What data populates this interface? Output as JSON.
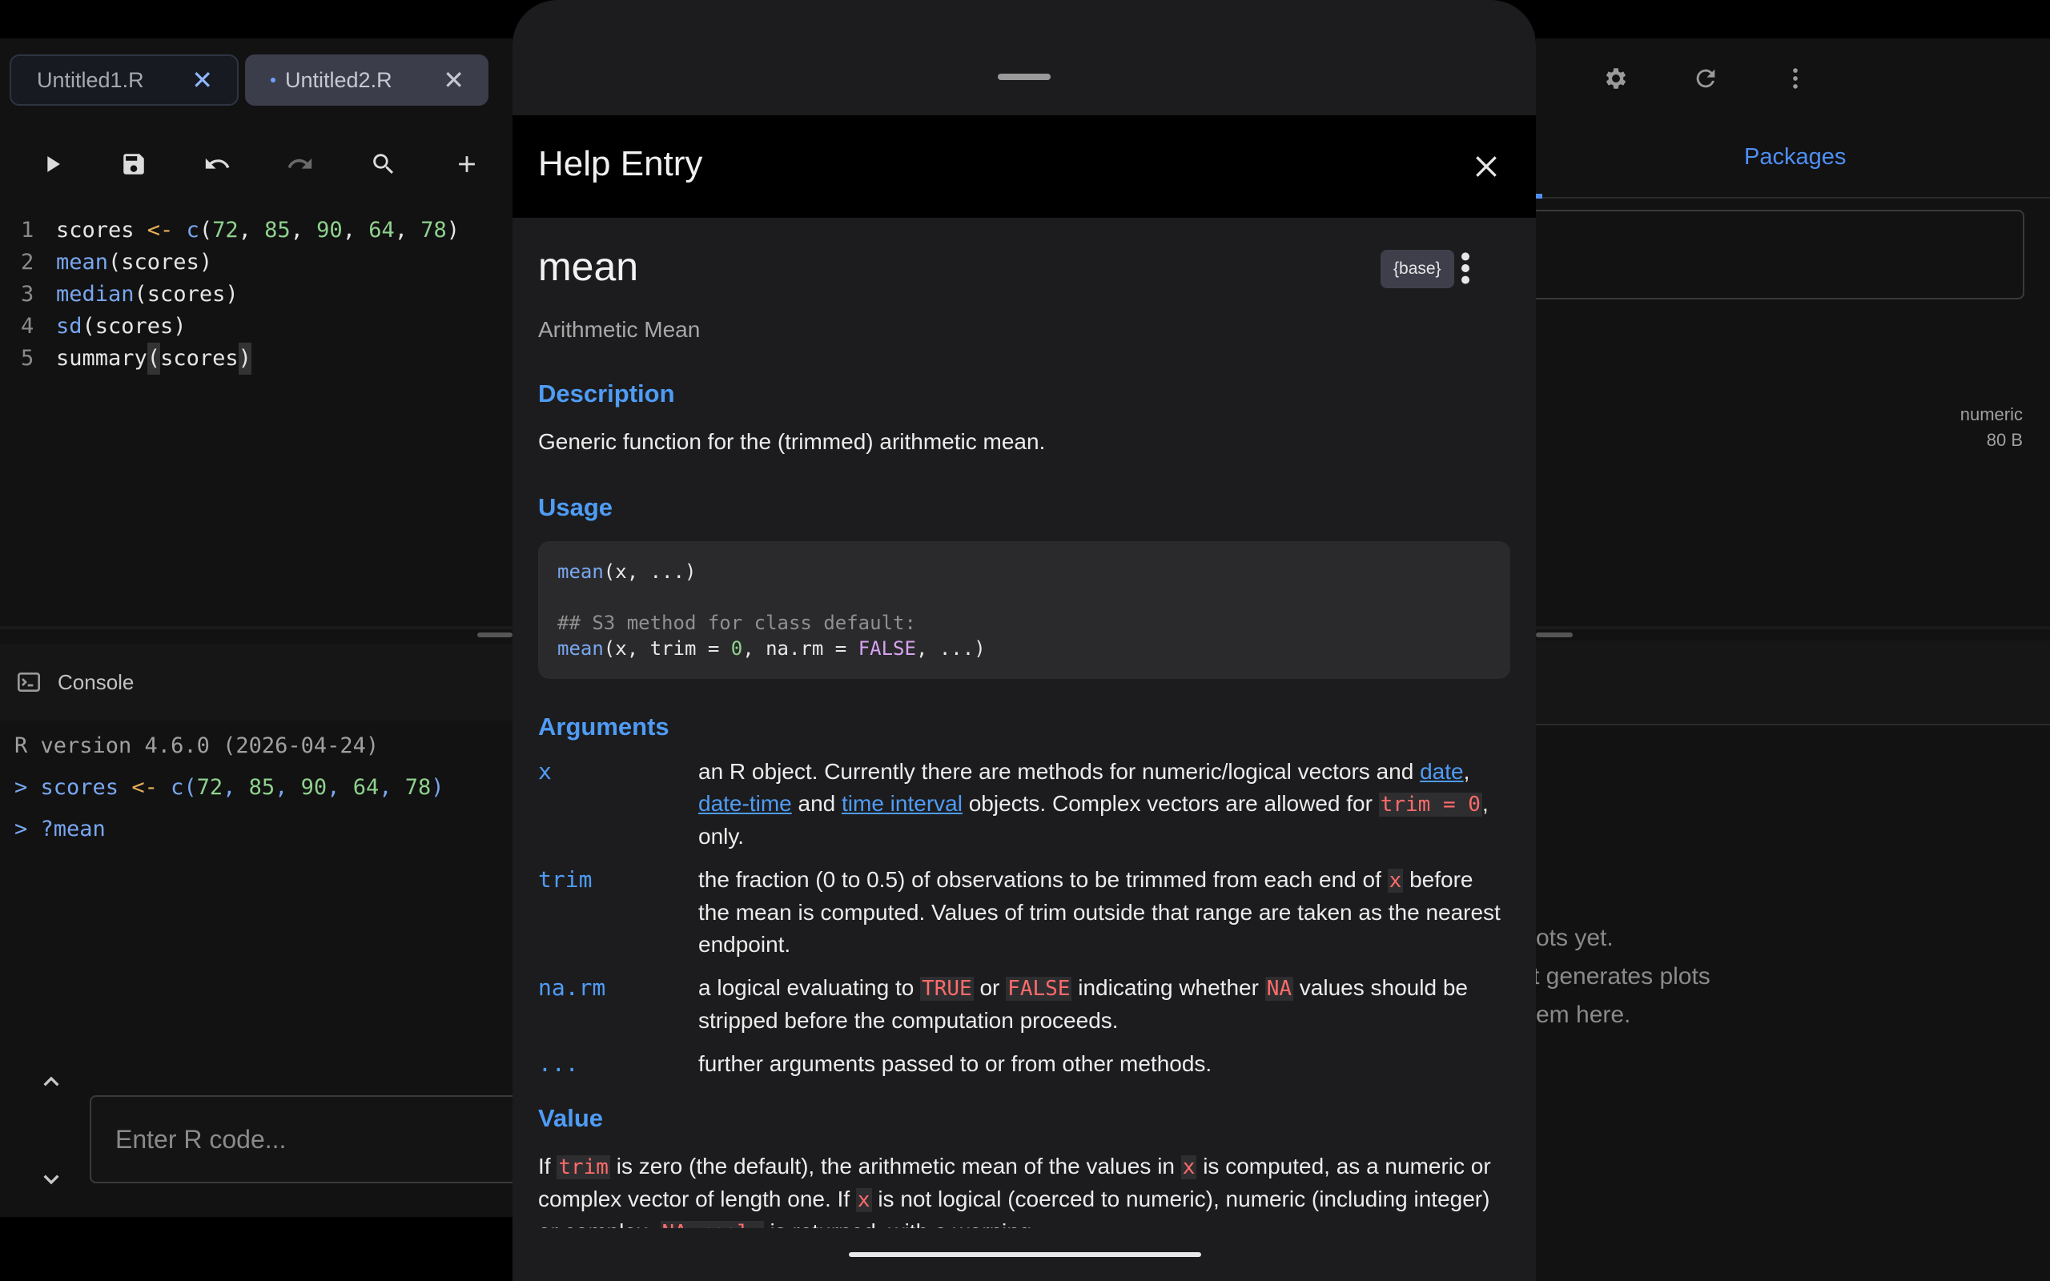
{
  "editor": {
    "tabs": [
      {
        "label": "Untitled1.R",
        "close": "✕"
      },
      {
        "label": "Untitled2.R",
        "close": "✕"
      }
    ],
    "code_lines": [
      {
        "n": "1",
        "parts": [
          [
            "scores ",
            "txt"
          ],
          [
            "<-",
            "op"
          ],
          [
            " ",
            "txt"
          ],
          [
            "c",
            "fn"
          ],
          [
            "(",
            "txt"
          ],
          [
            "72",
            "num"
          ],
          [
            ", ",
            "txt"
          ],
          [
            "85",
            "num"
          ],
          [
            ", ",
            "txt"
          ],
          [
            "90",
            "num"
          ],
          [
            ", ",
            "txt"
          ],
          [
            "64",
            "num"
          ],
          [
            ", ",
            "txt"
          ],
          [
            "78",
            "num"
          ],
          [
            ")",
            "txt"
          ]
        ]
      },
      {
        "n": "2",
        "parts": [
          [
            "mean",
            "fn"
          ],
          [
            "(scores)",
            "txt"
          ]
        ]
      },
      {
        "n": "3",
        "parts": [
          [
            "median",
            "fn"
          ],
          [
            "(scores)",
            "txt"
          ]
        ]
      },
      {
        "n": "4",
        "parts": [
          [
            "sd",
            "fn"
          ],
          [
            "(scores)",
            "txt"
          ]
        ]
      },
      {
        "n": "5",
        "parts": [
          [
            "summary",
            "txt"
          ],
          [
            "(",
            "hl"
          ],
          [
            "scores",
            "txt"
          ],
          [
            ")",
            "hl"
          ]
        ]
      }
    ]
  },
  "console": {
    "title": "Console",
    "lines": [
      {
        "prompt": "",
        "parts": [
          [
            "R version 4.6.0 (2026-04-24)",
            "dim"
          ]
        ]
      },
      {
        "prompt": "> ",
        "parts": [
          [
            "scores ",
            "fn"
          ],
          [
            "<-",
            "op"
          ],
          [
            " c(",
            "fn"
          ],
          [
            "72",
            "num"
          ],
          [
            ", ",
            "fn"
          ],
          [
            "85",
            "num"
          ],
          [
            ", ",
            "fn"
          ],
          [
            "90",
            "num"
          ],
          [
            ", ",
            "fn"
          ],
          [
            "64",
            "num"
          ],
          [
            ", ",
            "fn"
          ],
          [
            "78",
            "num"
          ],
          [
            ")",
            "fn"
          ]
        ]
      },
      {
        "prompt": "> ",
        "parts": [
          [
            "?mean",
            "fn"
          ]
        ]
      }
    ],
    "input_placeholder": "Enter R code..."
  },
  "right_pane": {
    "tab_label": "Packages",
    "env_type": "numeric",
    "env_size": "80 B",
    "empty_lines": [
      "ots yet.",
      "t generates plots",
      "em here."
    ]
  },
  "help": {
    "header_title": "Help Entry",
    "function_name": "mean",
    "package": "{base}",
    "subtitle": "Arithmetic Mean",
    "description_heading": "Description",
    "description": "Generic function for the (trimmed) arithmetic mean.",
    "usage_heading": "Usage",
    "arguments_heading": "Arguments",
    "value_heading": "Value",
    "arguments": [
      {
        "name": "x",
        "desc": [
          [
            "an R object. Currently there are methods for numeric/logical vectors and ",
            "t"
          ],
          [
            "date",
            "link"
          ],
          [
            ",\n",
            "t"
          ],
          [
            "date-time",
            "link"
          ],
          [
            " and ",
            "t"
          ],
          [
            "time interval",
            "link"
          ],
          [
            " objects. Complex vectors are allowed for ",
            "t"
          ],
          [
            "trim =\n0",
            "code"
          ],
          [
            ", only.",
            "t"
          ]
        ]
      },
      {
        "name": "trim",
        "desc": [
          [
            "the fraction (0 to 0.5) of observations to be trimmed from each end of ",
            "t"
          ],
          [
            "x",
            "code"
          ],
          [
            " before the mean is computed. Values of trim outside that range are taken as the nearest endpoint.",
            "t"
          ]
        ]
      },
      {
        "name": "na.rm",
        "desc": [
          [
            "a logical evaluating to ",
            "t"
          ],
          [
            "TRUE",
            "code"
          ],
          [
            " or ",
            "t"
          ],
          [
            "FALSE",
            "code"
          ],
          [
            " indicating whether ",
            "t"
          ],
          [
            "NA",
            "code"
          ],
          [
            " values should be stripped before the computation proceeds.",
            "t"
          ]
        ]
      },
      {
        "name": "...",
        "desc": [
          [
            "further arguments passed to or from other methods.",
            "t"
          ]
        ]
      }
    ],
    "value": [
      [
        "If ",
        "t"
      ],
      [
        "trim",
        "code"
      ],
      [
        " is zero (the default), the arithmetic mean of the values in ",
        "t"
      ],
      [
        "x",
        "code"
      ],
      [
        " is computed, as a numeric or complex vector of length one. If ",
        "t"
      ],
      [
        "x",
        "code"
      ],
      [
        " is not logical (coerced to numeric), numeric (including integer) or complex, ",
        "t"
      ],
      [
        "NA_real_",
        "code"
      ],
      [
        " is returned, with a warning.",
        "t"
      ]
    ]
  }
}
